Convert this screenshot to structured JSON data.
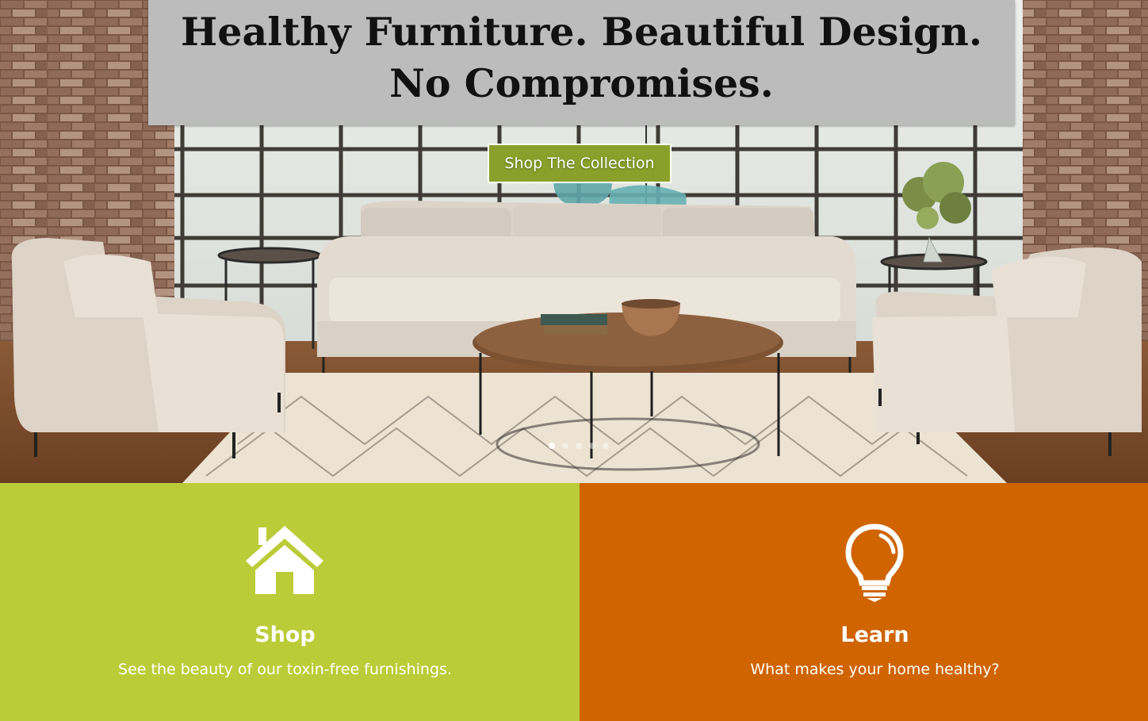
{
  "hero": {
    "headline_line1": "Healthy Furniture. Beautiful Design.",
    "headline_line2": "No Compromises.",
    "cta_label": "Shop The Collection",
    "slider": {
      "count": 5,
      "active_index": 0
    }
  },
  "features": {
    "shop": {
      "icon": "home-icon",
      "title": "Shop",
      "text": "See the beauty of our toxin-free furnishings."
    },
    "learn": {
      "icon": "lightbulb-icon",
      "title": "Learn",
      "text": "What makes your home healthy?"
    }
  },
  "colors": {
    "headline_box": "#bcbcbc",
    "cta_button": "#8aa02a",
    "shop_panel": "#bccc38",
    "learn_panel": "#cf6400",
    "text_light": "#ffffff"
  }
}
